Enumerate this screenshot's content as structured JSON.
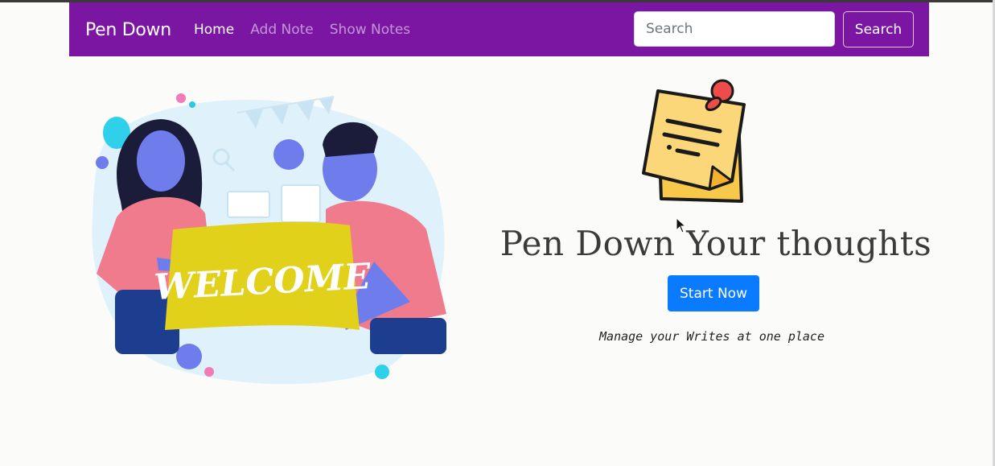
{
  "navbar": {
    "brand": "Pen Down",
    "links": [
      {
        "label": "Home",
        "active": true
      },
      {
        "label": "Add Note",
        "active": false
      },
      {
        "label": "Show Notes",
        "active": false
      }
    ],
    "search": {
      "placeholder": "Search",
      "value": "",
      "button_label": "Search"
    }
  },
  "hero": {
    "banner_text": "WELCOME",
    "tagline": "Pen Down Your thoughts",
    "cta_label": "Start Now",
    "subtitle": "Manage your Writes at one place"
  },
  "colors": {
    "navbar_bg": "#7b16a3",
    "cta_bg": "#0a7bff",
    "banner_yellow": "#e2d11a",
    "figure_blue": "#6f7dec",
    "shirt_pink": "#f07b8d"
  },
  "icons": [
    "sticky-note-icon",
    "pushpin-icon",
    "mouse-cursor-icon"
  ]
}
